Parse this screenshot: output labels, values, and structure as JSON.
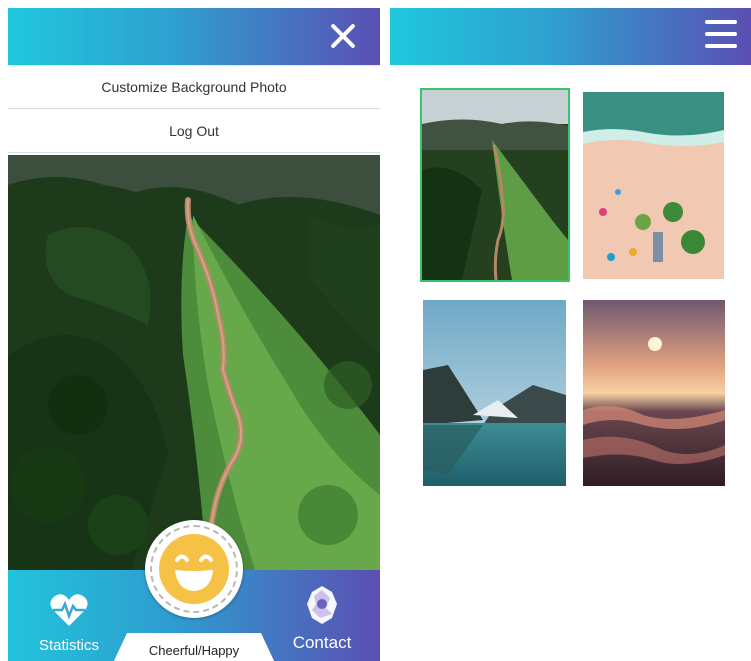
{
  "left_panel": {
    "menu": {
      "customize_label": "Customize Background Photo",
      "logout_label": "Log Out"
    },
    "bottom_nav": {
      "statistics_label": "Statistics",
      "contact_label": "Contact",
      "mood_label": "Cheerful/Happy"
    }
  },
  "right_panel": {
    "photos": [
      {
        "name": "mountain-trail",
        "selected": true
      },
      {
        "name": "beach-aerial",
        "selected": false
      },
      {
        "name": "mountain-lake",
        "selected": false
      },
      {
        "name": "sunset-sea",
        "selected": false
      }
    ]
  },
  "colors": {
    "header_gradient_start": "#1fc7dd",
    "header_gradient_end": "#5a4fb3",
    "selected_outline": "#3bc46a",
    "mood_face": "#f6c246"
  }
}
